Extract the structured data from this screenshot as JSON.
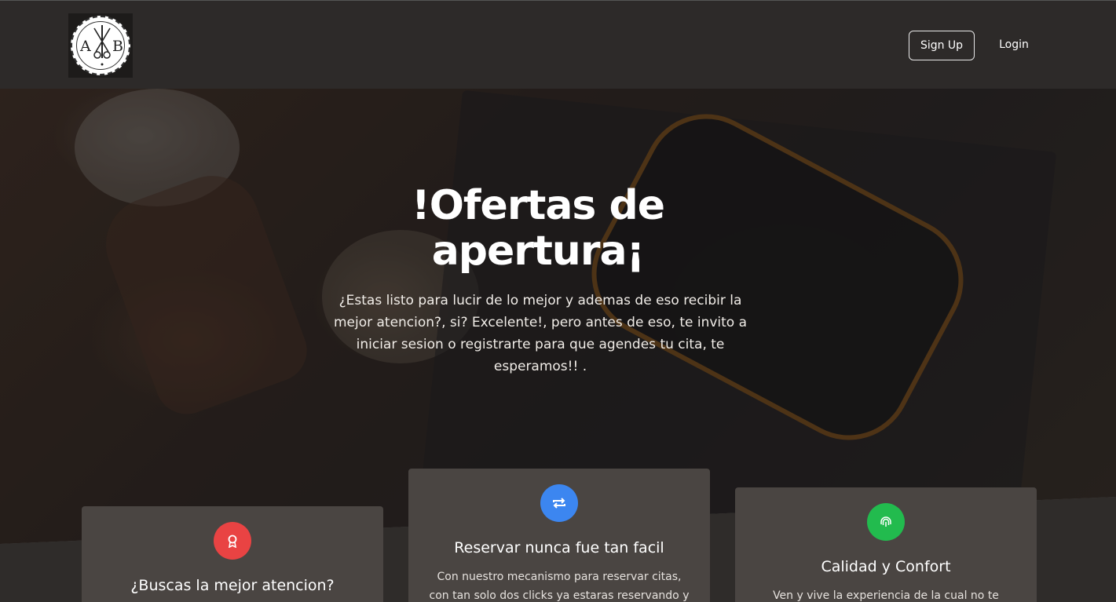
{
  "header": {
    "logo": {
      "letter_left": "A",
      "letter_right": "B"
    },
    "signup_label": "Sign Up",
    "login_label": "Login"
  },
  "hero": {
    "title": "!Ofertas de apertura¡",
    "text": "¿Estas listo para lucir de lo mejor y ademas de eso recibir la mejor atencion?, si? Excelente!, pero antes de eso, te invito a iniciar sesion o registrarte para que agendes tu cita, te esperamos!! ."
  },
  "cards": [
    {
      "icon": "award-icon",
      "color": "#e94343",
      "title": "¿Buscas la mejor atencion?",
      "text": ""
    },
    {
      "icon": "repeat-icon",
      "color": "#3c86f0",
      "title": "Reservar nunca fue tan facil",
      "text": "Con nuestro mecanismo para reservar citas, con tan solo dos clicks ya estaras reservando y"
    },
    {
      "icon": "fingerprint-icon",
      "color": "#22bb4e",
      "title": "Calidad y Confort",
      "text": "Ven y vive la experiencia de la cual no te"
    }
  ]
}
